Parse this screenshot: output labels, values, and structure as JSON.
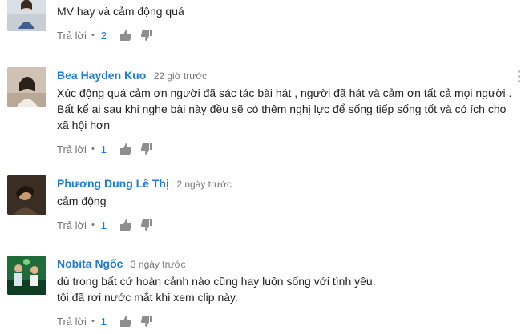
{
  "comments": [
    {
      "author": "",
      "time": "",
      "lines": [
        "MV hay và cảm động quá"
      ],
      "reply_label": "Trả lời",
      "separator": "•",
      "likes": "2",
      "avatar_icon": "avatar-woman-outdoor"
    },
    {
      "author": "Bea Hayden Kuo",
      "time": "22 giờ trước",
      "lines": [
        "Xúc động quá cảm ơn người đã sác tác bài hát , người đã hát và cảm ơn tất cả mọi người .",
        "Bất kể ai sau khi nghe bài này đều sẽ có thêm nghị lực để sống tiếp sống tốt và có ích cho",
        "xã hội hơn"
      ],
      "reply_label": "Trả lời",
      "separator": "•",
      "likes": "1",
      "avatar_icon": "avatar-woman-indoor"
    },
    {
      "author": "Phương Dung Lê Thị",
      "time": "2 ngày trước",
      "lines": [
        "cảm động"
      ],
      "reply_label": "Trả lời",
      "separator": "•",
      "likes": "1",
      "avatar_icon": "avatar-woman-dark"
    },
    {
      "author": "Nobita Ngốc",
      "time": "3 ngày trước",
      "lines": [
        "dù trong bất cứ hoàn cảnh nào cũng hay luôn sống với tình yêu.",
        "tôi đã rơi nước mắt khi xem clip này."
      ],
      "reply_label": "Trả lời",
      "separator": "•",
      "likes": "1",
      "avatar_icon": "avatar-group-green"
    }
  ],
  "colors": {
    "author": "#1f7bd6",
    "likes": "#1f7bd6",
    "muted": "#767676",
    "text": "#222222",
    "thumb": "#8e8e8e"
  }
}
